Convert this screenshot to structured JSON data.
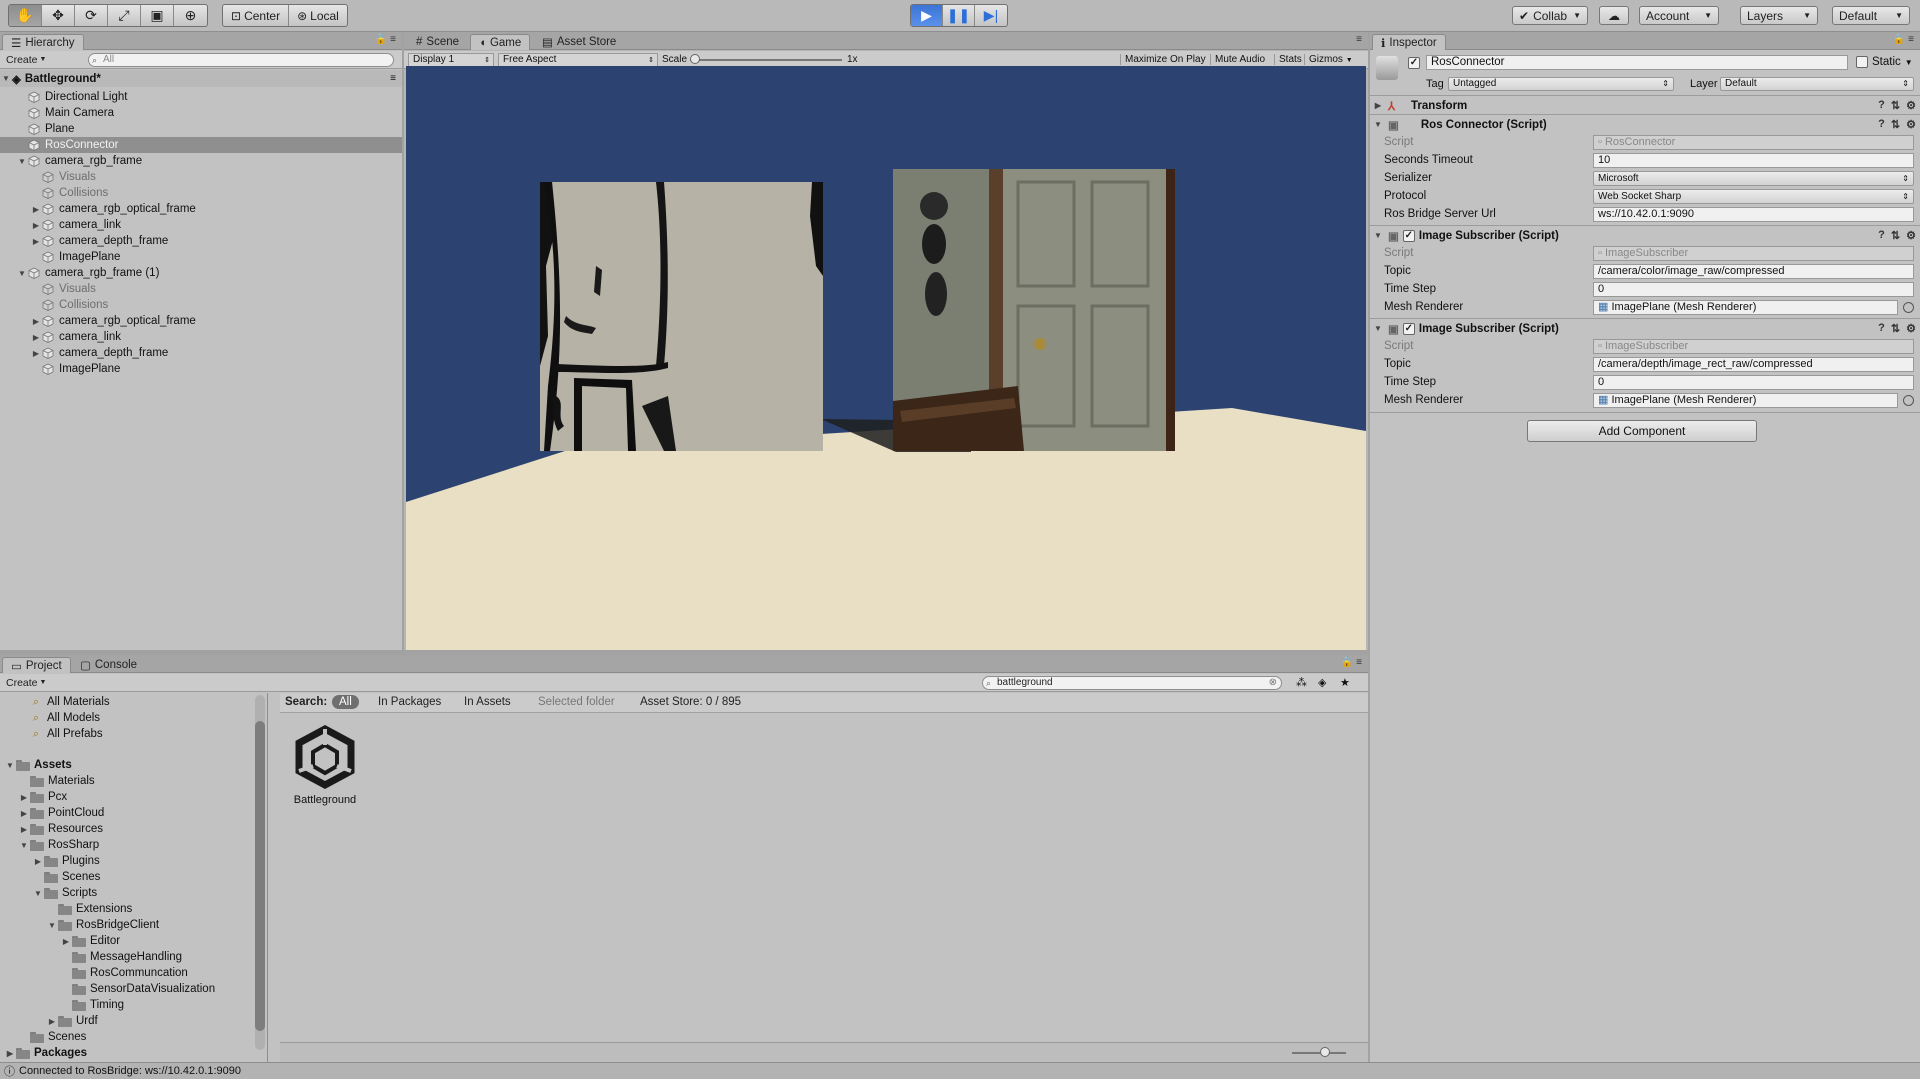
{
  "toolbar": {
    "tools": [
      "hand-icon",
      "move-icon",
      "rotate-icon",
      "scale-icon",
      "rect-icon",
      "transform-icon"
    ],
    "pivot_label": "Center",
    "space_label": "Local",
    "collab_label": "Collab",
    "account_label": "Account",
    "layers_label": "Layers",
    "layout_label": "Default"
  },
  "hierarchy": {
    "tab_label": "Hierarchy",
    "create_label": "Create",
    "search_placeholder": "All",
    "scene_name": "Battleground*",
    "items": [
      {
        "label": "Directional Light"
      },
      {
        "label": "Main Camera"
      },
      {
        "label": "Plane"
      },
      {
        "label": "RosConnector"
      },
      {
        "label": "camera_rgb_frame"
      },
      {
        "label": "Visuals"
      },
      {
        "label": "Collisions"
      },
      {
        "label": "camera_rgb_optical_frame"
      },
      {
        "label": "camera_link"
      },
      {
        "label": "camera_depth_frame"
      },
      {
        "label": "ImagePlane"
      },
      {
        "label": "camera_rgb_frame (1)"
      },
      {
        "label": "Visuals"
      },
      {
        "label": "Collisions"
      },
      {
        "label": "camera_rgb_optical_frame"
      },
      {
        "label": "camera_link"
      },
      {
        "label": "camera_depth_frame"
      },
      {
        "label": "ImagePlane"
      }
    ]
  },
  "game": {
    "tabs": [
      {
        "label": "Scene"
      },
      {
        "label": "Game"
      },
      {
        "label": "Asset Store"
      }
    ],
    "display_label": "Display 1",
    "aspect_label": "Free Aspect",
    "scale_label": "Scale",
    "scale_value": "1x",
    "maximize_label": "Maximize On Play",
    "mute_label": "Mute Audio",
    "stats_label": "Stats",
    "gizmos_label": "Gizmos",
    "colors": {
      "sky": "#2c4270",
      "floor": "#e8dfc5"
    }
  },
  "inspector": {
    "tab_label": "Inspector",
    "object_name": "RosConnector",
    "static_label": "Static",
    "tag_label": "Tag",
    "tag_value": "Untagged",
    "layer_label": "Layer",
    "layer_value": "Default",
    "transform_title": "Transform",
    "ros_connector": {
      "title": "Ros Connector (Script)",
      "script_label": "Script",
      "script_value": "RosConnector",
      "timeout_label": "Seconds Timeout",
      "timeout_value": "10",
      "serializer_label": "Serializer",
      "serializer_value": "Microsoft",
      "protocol_label": "Protocol",
      "protocol_value": "Web Socket Sharp",
      "url_label": "Ros Bridge Server Url",
      "url_value": "ws://10.42.0.1:9090"
    },
    "subscribers": [
      {
        "title": "Image Subscriber (Script)",
        "script_label": "Script",
        "script_value": "ImageSubscriber",
        "topic_label": "Topic",
        "topic_value": "/camera/color/image_raw/compressed",
        "timestep_label": "Time Step",
        "timestep_value": "0",
        "mesh_label": "Mesh Renderer",
        "mesh_value": "ImagePlane (Mesh Renderer)"
      },
      {
        "title": "Image Subscriber (Script)",
        "script_label": "Script",
        "script_value": "ImageSubscriber",
        "topic_label": "Topic",
        "topic_value": "/camera/depth/image_rect_raw/compressed",
        "timestep_label": "Time Step",
        "timestep_value": "0",
        "mesh_label": "Mesh Renderer",
        "mesh_value": "ImagePlane (Mesh Renderer)"
      }
    ],
    "add_component_label": "Add Component"
  },
  "project": {
    "tabs": [
      {
        "label": "Project"
      },
      {
        "label": "Console"
      }
    ],
    "create_label": "Create",
    "search_value": "battleground",
    "search_label": "Search:",
    "search_options": [
      "All",
      "In Packages",
      "In Assets",
      "Selected folder",
      "Asset Store: 0 / 895"
    ],
    "favorites": [
      "All Materials",
      "All Models",
      "All Prefabs"
    ],
    "tree": [
      {
        "label": "Assets"
      },
      {
        "label": "Materials"
      },
      {
        "label": "Pcx"
      },
      {
        "label": "PointCloud"
      },
      {
        "label": "Resources"
      },
      {
        "label": "RosSharp"
      },
      {
        "label": "Plugins"
      },
      {
        "label": "Scenes"
      },
      {
        "label": "Scripts"
      },
      {
        "label": "Extensions"
      },
      {
        "label": "RosBridgeClient"
      },
      {
        "label": "Editor"
      },
      {
        "label": "MessageHandling"
      },
      {
        "label": "RosCommuncation"
      },
      {
        "label": "SensorDataVisualization"
      },
      {
        "label": "Timing"
      },
      {
        "label": "Urdf"
      },
      {
        "label": "Scenes"
      },
      {
        "label": "Packages"
      }
    ],
    "asset_label": "Battleground"
  },
  "status": {
    "message": "Connected to RosBridge: ws://10.42.0.1:9090"
  }
}
